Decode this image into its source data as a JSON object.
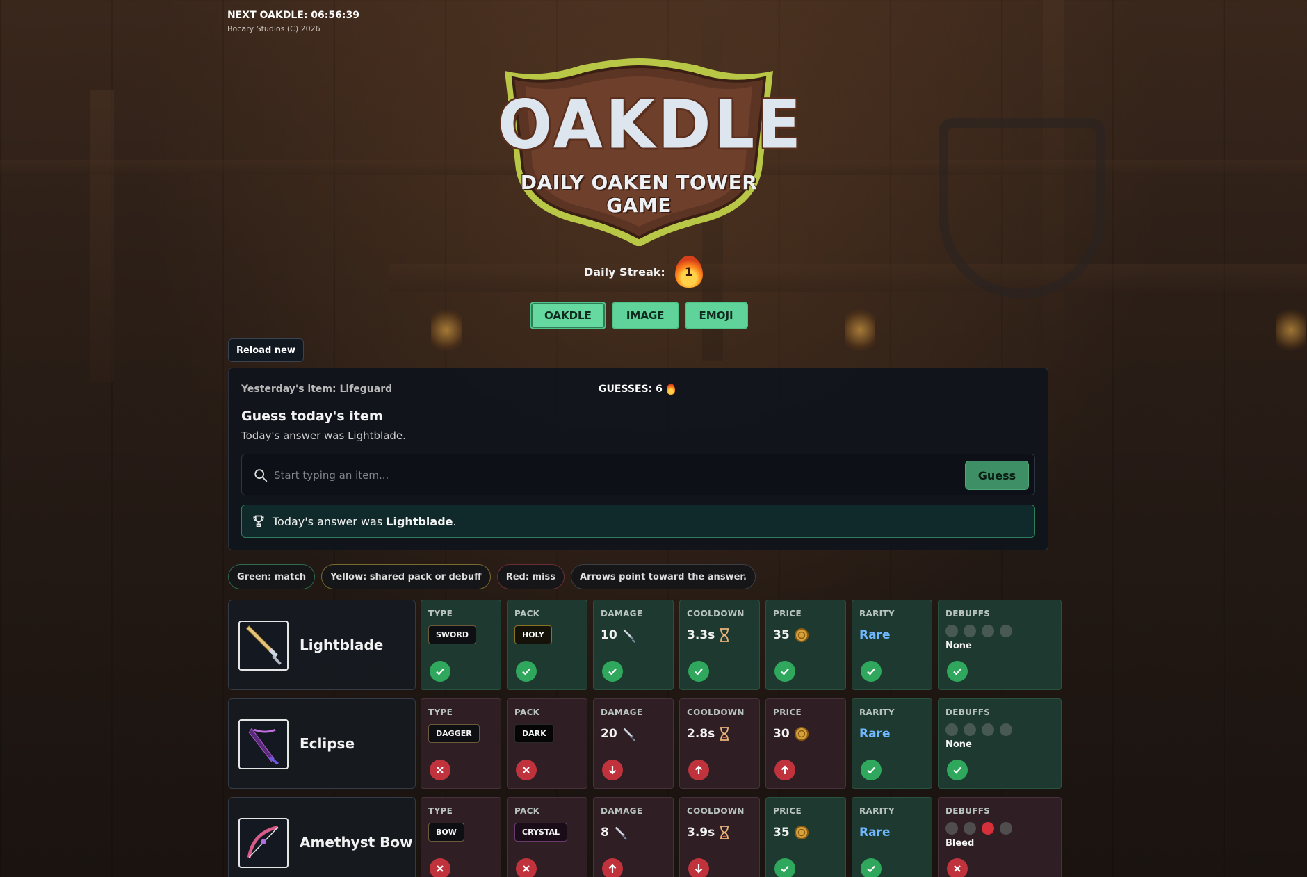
{
  "header": {
    "next_oakdle": "NEXT OAKDLE: 06:56:39",
    "copyright": "Bocary Studios (C) 2026"
  },
  "logo": {
    "title": "OAKDLE",
    "subtitle": "DAILY OAKEN TOWER GAME"
  },
  "streak": {
    "label": "Daily Streak:",
    "count": "1"
  },
  "modes": [
    {
      "label": "OAKDLE",
      "active": true
    },
    {
      "label": "IMAGE",
      "active": false
    },
    {
      "label": "EMOJI",
      "active": false
    }
  ],
  "reload_label": "Reload new",
  "panel": {
    "yesterday": "Yesterday's item: Lifeguard",
    "guesses": "GUESSES: 6",
    "title": "Guess today's item",
    "subtitle": "Today's answer was Lightblade.",
    "search_placeholder": "Start typing an item...",
    "guess_button": "Guess",
    "answer_prefix": "Today's answer was",
    "answer_name": "Lightblade",
    "answer_suffix": "."
  },
  "legend": [
    "Green: match",
    "Yellow: shared pack or debuff",
    "Red: miss",
    "Arrows point toward the answer."
  ],
  "columns": [
    "TYPE",
    "PACK",
    "DAMAGE",
    "COOLDOWN",
    "PRICE",
    "RARITY",
    "DEBUFFS"
  ],
  "rows": [
    {
      "name": "Lightblade",
      "type": "SWORD",
      "pack": "HOLY",
      "damage": "10",
      "cooldown": "3.3s",
      "price": "35",
      "rarity": "Rare",
      "debuffs": "None",
      "status": [
        "match",
        "match",
        "match",
        "match",
        "match",
        "match",
        "match"
      ]
    },
    {
      "name": "Eclipse",
      "type": "DAGGER",
      "pack": "DARK",
      "damage": "20",
      "cooldown": "2.8s",
      "price": "30",
      "rarity": "Rare",
      "debuffs": "None",
      "status": [
        "miss",
        "miss",
        "down",
        "up",
        "up",
        "match",
        "match"
      ]
    },
    {
      "name": "Amethyst Bow",
      "type": "BOW",
      "pack": "CRYSTAL",
      "damage": "8",
      "cooldown": "3.9s",
      "price": "35",
      "rarity": "Rare",
      "debuffs": "Bleed",
      "status": [
        "miss",
        "miss",
        "up",
        "down",
        "match",
        "match",
        "miss"
      ]
    }
  ],
  "colors": {
    "match_bg": "#1e3a30",
    "miss_bg": "#2f1f24",
    "mode_button": "#5fd39a",
    "rare_text": "#6fb8ff",
    "ok_badge": "#2fa85d",
    "bad_badge": "#c0333d"
  }
}
